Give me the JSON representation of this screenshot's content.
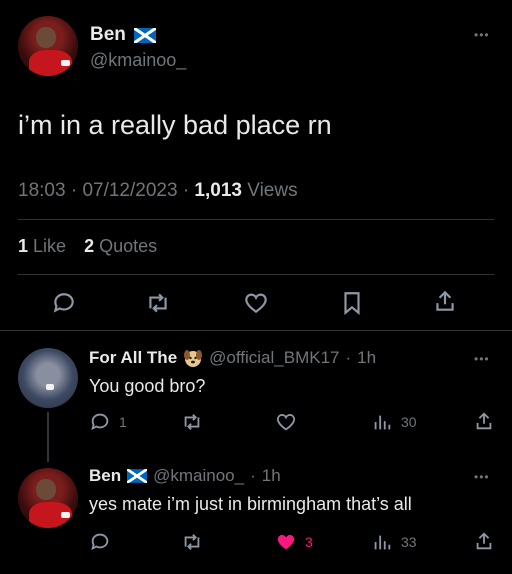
{
  "main_tweet": {
    "author_name": "Ben",
    "handle": "@kmainoo_",
    "text": "i’m in a really bad place rn",
    "time": "18:03",
    "date": "07/12/2023",
    "views_count": "1,013",
    "views_label": "Views",
    "likes_count": "1",
    "likes_label": "Like",
    "quotes_count": "2",
    "quotes_label": "Quotes"
  },
  "replies": [
    {
      "author_name": "For All The",
      "handle": "@official_BMK17",
      "time": "1h",
      "text": "You good bro?",
      "reply_count": "1",
      "like_count": "",
      "views_count": "30"
    },
    {
      "author_name": "Ben",
      "handle": "@kmainoo_",
      "time": "1h",
      "text": "yes mate i’m just in birmingham that’s all",
      "reply_count": "",
      "like_count": "3",
      "views_count": "33"
    }
  ],
  "icons": {
    "flag": "scotland-flag-icon",
    "verified_emoji": "dog-emoji-icon",
    "more": "more-dots-icon",
    "reply": "reply-icon",
    "retweet": "retweet-icon",
    "like": "heart-icon",
    "bookmark": "bookmark-icon",
    "share": "share-icon",
    "views": "analytics-icon"
  },
  "colors": {
    "background": "#000000",
    "text": "#e7e9ea",
    "muted": "#71767b",
    "divider": "#2f3336",
    "like_active": "#f91880",
    "flag_blue": "#0065bd"
  }
}
